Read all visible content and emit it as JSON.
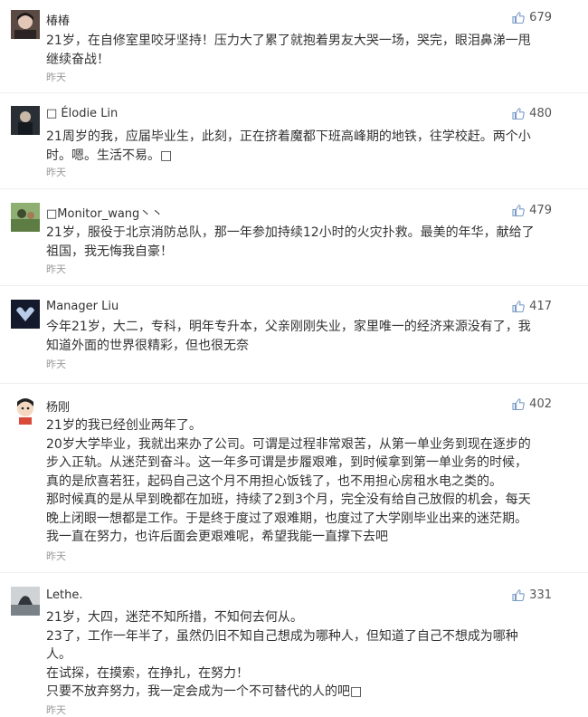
{
  "comments": [
    {
      "user": "椿椿",
      "likes": "679",
      "lines": [
        "21岁，在自修室里咬牙坚持！压力大了累了就抱着男友大哭一场，哭完，眼泪鼻涕一甩",
        "继续奋战！"
      ],
      "time": "昨天"
    },
    {
      "user": "□ Élodie Lin",
      "likes": "480",
      "lines": [
        "21周岁的我，应届毕业生，此刻，正在挤着魔都下班高峰期的地铁，往学校赶。两个小",
        "时。嗯。生活不易。□"
      ],
      "time": "昨天"
    },
    {
      "user": "□Monitor_wang丶丶",
      "likes": "479",
      "lines": [
        "21岁，服役于北京消防总队，那一年参加持续12小时的火灾扑救。最美的年华，献给了",
        "祖国，我无悔我自豪！"
      ],
      "time": "昨天"
    },
    {
      "user": "Manager Liu",
      "likes": "417",
      "lines": [
        "今年21岁，大二，专科，明年专升本，父亲刚刚失业，家里唯一的经济来源没有了，我",
        "知道外面的世界很精彩，但也很无奈"
      ],
      "time": "昨天"
    },
    {
      "user": "杨刚",
      "likes": "402",
      "lines": [
        "21岁的我已经创业两年了。",
        "20岁大学毕业，我就出来办了公司。可谓是过程非常艰苦，从第一单业务到现在逐步的",
        "步入正轨。从迷茫到奋斗。这一年多可谓是步履艰难，到时候拿到第一单业务的时候，",
        "真的是欣喜若狂，起码自己这个月不用担心饭钱了，也不用担心房租水电之类的。",
        "那时候真的是从早到晚都在加班，持续了2到3个月，完全没有给自己放假的机会，每天",
        "晚上闭眼一想都是工作。于是终于度过了艰难期，也度过了大学刚毕业出来的迷茫期。",
        "我一直在努力，也许后面会更艰难呢，希望我能一直撑下去吧"
      ],
      "time": "昨天"
    },
    {
      "user": "Lethe.",
      "likes": "331",
      "lines": [
        "21岁，大四，迷茫不知所措，不知何去何从。",
        "23了，工作一年半了，虽然仍旧不知自己想成为哪种人，但知道了自己不想成为哪种",
        "人。",
        "在试探，在摸索，在挣扎，在努力！",
        "只要不放弃努力，我一定会成为一个不可替代的人的吧□"
      ],
      "time": "昨天"
    }
  ],
  "icons": {
    "like": "thumbs-up-icon"
  },
  "colors": {
    "text": "#333333",
    "meta": "#999999",
    "like_icon": "#7a9cc6",
    "separator": "#eeeeee"
  }
}
